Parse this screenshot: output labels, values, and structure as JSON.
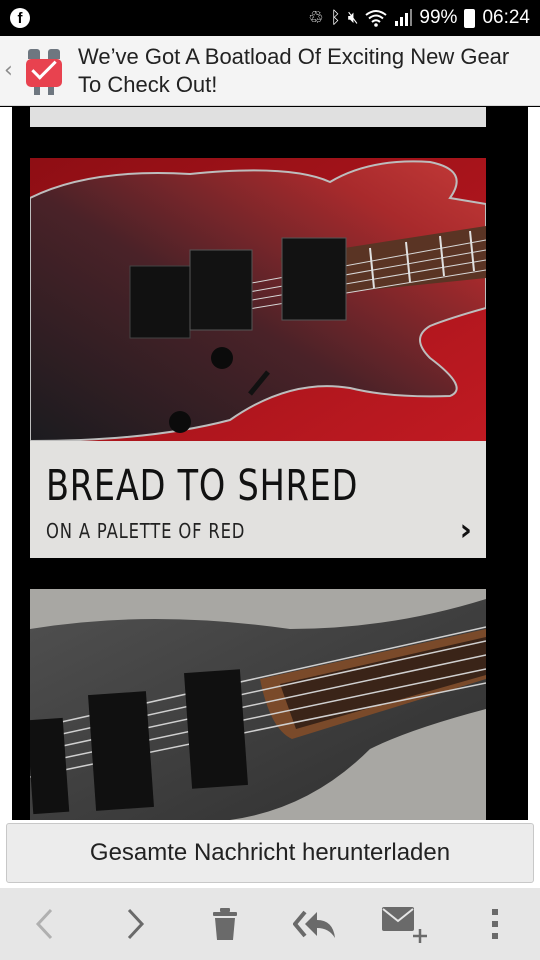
{
  "status_bar": {
    "app_icon": "facebook-icon",
    "battery": "99%",
    "time": "06:24",
    "icons": [
      "sync-icon",
      "bluetooth-icon",
      "mute-icon",
      "wifi-icon",
      "signal-icon",
      "battery-icon"
    ]
  },
  "header": {
    "back_icon": "chevron-left-icon",
    "app_icon": "mail-app-icon",
    "subject": "We’ve Got A Boatload Of Exciting New Gear To Check Out!"
  },
  "email": {
    "feature": {
      "image": "red-electric-guitar-photo",
      "title": "BREAD TO SHRED",
      "subtitle": "ON A PALETTE OF RED",
      "arrow_icon": "chevron-right-icon"
    },
    "next_image": "grey-bass-guitar-photo"
  },
  "download": {
    "label": "Gesamte Nachricht herunterladen"
  },
  "toolbar": {
    "items": [
      "previous-icon",
      "next-icon",
      "delete-icon",
      "reply-all-icon",
      "compose-icon",
      "more-icon"
    ]
  },
  "colors": {
    "accent_red": "#e8424f",
    "card_bg": "#e2e1df",
    "toolbar_bg": "#e6e6e6"
  }
}
